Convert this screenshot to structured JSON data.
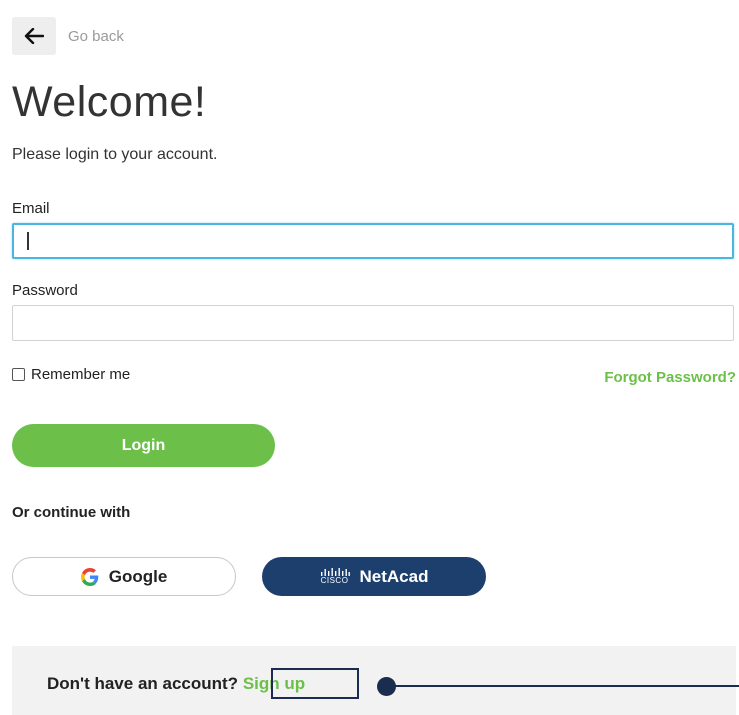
{
  "header": {
    "back_label": "Go back",
    "back_icon": "arrow-left-icon"
  },
  "page": {
    "title": "Welcome!",
    "subtitle": "Please login to your account."
  },
  "form": {
    "email_label": "Email",
    "email_value": "",
    "password_label": "Password",
    "password_value": "",
    "remember_label": "Remember me",
    "remember_checked": false,
    "forgot_label": "Forgot Password?",
    "login_label": "Login"
  },
  "social": {
    "continue_label": "Or continue with",
    "google_label": "Google",
    "netacad_label": "NetAcad",
    "cisco_word": "CISCO"
  },
  "footer": {
    "prompt": "Don't have an account?",
    "signup_label": "Sign up"
  },
  "colors": {
    "accent_green": "#6cc04a",
    "netacad_blue": "#1d3f6e",
    "annotation_navy": "#1a2d4f",
    "focus_blue": "#4ab5e0"
  }
}
